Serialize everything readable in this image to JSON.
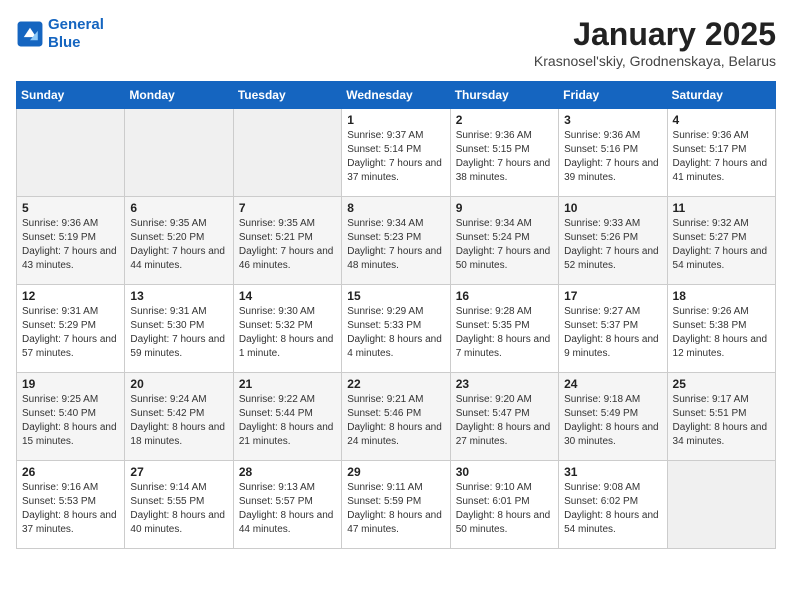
{
  "header": {
    "logo_line1": "General",
    "logo_line2": "Blue",
    "month": "January 2025",
    "location": "Krasnosel'skiy, Grodnenskaya, Belarus"
  },
  "weekdays": [
    "Sunday",
    "Monday",
    "Tuesday",
    "Wednesday",
    "Thursday",
    "Friday",
    "Saturday"
  ],
  "weeks": [
    [
      {
        "day": "",
        "sunrise": "",
        "sunset": "",
        "daylight": "",
        "empty": true
      },
      {
        "day": "",
        "sunrise": "",
        "sunset": "",
        "daylight": "",
        "empty": true
      },
      {
        "day": "",
        "sunrise": "",
        "sunset": "",
        "daylight": "",
        "empty": true
      },
      {
        "day": "1",
        "sunrise": "Sunrise: 9:37 AM",
        "sunset": "Sunset: 5:14 PM",
        "daylight": "Daylight: 7 hours and 37 minutes."
      },
      {
        "day": "2",
        "sunrise": "Sunrise: 9:36 AM",
        "sunset": "Sunset: 5:15 PM",
        "daylight": "Daylight: 7 hours and 38 minutes."
      },
      {
        "day": "3",
        "sunrise": "Sunrise: 9:36 AM",
        "sunset": "Sunset: 5:16 PM",
        "daylight": "Daylight: 7 hours and 39 minutes."
      },
      {
        "day": "4",
        "sunrise": "Sunrise: 9:36 AM",
        "sunset": "Sunset: 5:17 PM",
        "daylight": "Daylight: 7 hours and 41 minutes."
      }
    ],
    [
      {
        "day": "5",
        "sunrise": "Sunrise: 9:36 AM",
        "sunset": "Sunset: 5:19 PM",
        "daylight": "Daylight: 7 hours and 43 minutes."
      },
      {
        "day": "6",
        "sunrise": "Sunrise: 9:35 AM",
        "sunset": "Sunset: 5:20 PM",
        "daylight": "Daylight: 7 hours and 44 minutes."
      },
      {
        "day": "7",
        "sunrise": "Sunrise: 9:35 AM",
        "sunset": "Sunset: 5:21 PM",
        "daylight": "Daylight: 7 hours and 46 minutes."
      },
      {
        "day": "8",
        "sunrise": "Sunrise: 9:34 AM",
        "sunset": "Sunset: 5:23 PM",
        "daylight": "Daylight: 7 hours and 48 minutes."
      },
      {
        "day": "9",
        "sunrise": "Sunrise: 9:34 AM",
        "sunset": "Sunset: 5:24 PM",
        "daylight": "Daylight: 7 hours and 50 minutes."
      },
      {
        "day": "10",
        "sunrise": "Sunrise: 9:33 AM",
        "sunset": "Sunset: 5:26 PM",
        "daylight": "Daylight: 7 hours and 52 minutes."
      },
      {
        "day": "11",
        "sunrise": "Sunrise: 9:32 AM",
        "sunset": "Sunset: 5:27 PM",
        "daylight": "Daylight: 7 hours and 54 minutes."
      }
    ],
    [
      {
        "day": "12",
        "sunrise": "Sunrise: 9:31 AM",
        "sunset": "Sunset: 5:29 PM",
        "daylight": "Daylight: 7 hours and 57 minutes."
      },
      {
        "day": "13",
        "sunrise": "Sunrise: 9:31 AM",
        "sunset": "Sunset: 5:30 PM",
        "daylight": "Daylight: 7 hours and 59 minutes."
      },
      {
        "day": "14",
        "sunrise": "Sunrise: 9:30 AM",
        "sunset": "Sunset: 5:32 PM",
        "daylight": "Daylight: 8 hours and 1 minute."
      },
      {
        "day": "15",
        "sunrise": "Sunrise: 9:29 AM",
        "sunset": "Sunset: 5:33 PM",
        "daylight": "Daylight: 8 hours and 4 minutes."
      },
      {
        "day": "16",
        "sunrise": "Sunrise: 9:28 AM",
        "sunset": "Sunset: 5:35 PM",
        "daylight": "Daylight: 8 hours and 7 minutes."
      },
      {
        "day": "17",
        "sunrise": "Sunrise: 9:27 AM",
        "sunset": "Sunset: 5:37 PM",
        "daylight": "Daylight: 8 hours and 9 minutes."
      },
      {
        "day": "18",
        "sunrise": "Sunrise: 9:26 AM",
        "sunset": "Sunset: 5:38 PM",
        "daylight": "Daylight: 8 hours and 12 minutes."
      }
    ],
    [
      {
        "day": "19",
        "sunrise": "Sunrise: 9:25 AM",
        "sunset": "Sunset: 5:40 PM",
        "daylight": "Daylight: 8 hours and 15 minutes."
      },
      {
        "day": "20",
        "sunrise": "Sunrise: 9:24 AM",
        "sunset": "Sunset: 5:42 PM",
        "daylight": "Daylight: 8 hours and 18 minutes."
      },
      {
        "day": "21",
        "sunrise": "Sunrise: 9:22 AM",
        "sunset": "Sunset: 5:44 PM",
        "daylight": "Daylight: 8 hours and 21 minutes."
      },
      {
        "day": "22",
        "sunrise": "Sunrise: 9:21 AM",
        "sunset": "Sunset: 5:46 PM",
        "daylight": "Daylight: 8 hours and 24 minutes."
      },
      {
        "day": "23",
        "sunrise": "Sunrise: 9:20 AM",
        "sunset": "Sunset: 5:47 PM",
        "daylight": "Daylight: 8 hours and 27 minutes."
      },
      {
        "day": "24",
        "sunrise": "Sunrise: 9:18 AM",
        "sunset": "Sunset: 5:49 PM",
        "daylight": "Daylight: 8 hours and 30 minutes."
      },
      {
        "day": "25",
        "sunrise": "Sunrise: 9:17 AM",
        "sunset": "Sunset: 5:51 PM",
        "daylight": "Daylight: 8 hours and 34 minutes."
      }
    ],
    [
      {
        "day": "26",
        "sunrise": "Sunrise: 9:16 AM",
        "sunset": "Sunset: 5:53 PM",
        "daylight": "Daylight: 8 hours and 37 minutes."
      },
      {
        "day": "27",
        "sunrise": "Sunrise: 9:14 AM",
        "sunset": "Sunset: 5:55 PM",
        "daylight": "Daylight: 8 hours and 40 minutes."
      },
      {
        "day": "28",
        "sunrise": "Sunrise: 9:13 AM",
        "sunset": "Sunset: 5:57 PM",
        "daylight": "Daylight: 8 hours and 44 minutes."
      },
      {
        "day": "29",
        "sunrise": "Sunrise: 9:11 AM",
        "sunset": "Sunset: 5:59 PM",
        "daylight": "Daylight: 8 hours and 47 minutes."
      },
      {
        "day": "30",
        "sunrise": "Sunrise: 9:10 AM",
        "sunset": "Sunset: 6:01 PM",
        "daylight": "Daylight: 8 hours and 50 minutes."
      },
      {
        "day": "31",
        "sunrise": "Sunrise: 9:08 AM",
        "sunset": "Sunset: 6:02 PM",
        "daylight": "Daylight: 8 hours and 54 minutes."
      },
      {
        "day": "",
        "sunrise": "",
        "sunset": "",
        "daylight": "",
        "empty": true
      }
    ]
  ]
}
